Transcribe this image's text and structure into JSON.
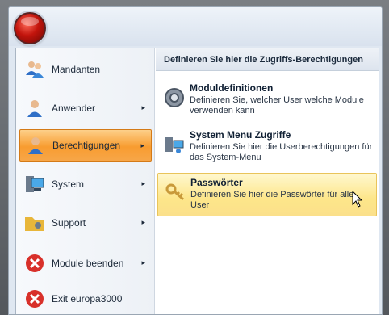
{
  "menu": {
    "items": [
      {
        "label": "Mandanten",
        "icon": "users-icon"
      },
      {
        "label": "Anwender",
        "icon": "user-icon",
        "arrow": "▸"
      },
      {
        "label": "Berechtigungen",
        "icon": "user-orange-icon",
        "arrow": "▸"
      },
      {
        "label": "System",
        "icon": "computer-icon",
        "arrow": "▸"
      },
      {
        "label": "Support",
        "icon": "folder-icon",
        "arrow": "▸"
      },
      {
        "label": "Module beenden",
        "icon": "close-red-icon",
        "arrow": "▸"
      },
      {
        "label": "Exit europa3000",
        "icon": "exit-red-icon"
      }
    ]
  },
  "submenu": {
    "header": "Definieren Sie hier die Zugriffs-Berechtigungen",
    "items": [
      {
        "title": "Moduldefinitionen",
        "desc": "Definieren Sie, welcher User welche Module verwenden kann",
        "icon": "disc-icon"
      },
      {
        "title": "System Menu Zugriffe",
        "desc": "Definieren Sie hier die Userberechtigungen für das System-Menu",
        "icon": "network-icon"
      },
      {
        "title": "Passwörter",
        "desc": "Definieren Sie hier die Passwörter für alle User",
        "icon": "keys-icon"
      }
    ]
  },
  "colors": {
    "active": "#f89c30",
    "highlight": "#fde68a",
    "orb": "#c2140c"
  }
}
